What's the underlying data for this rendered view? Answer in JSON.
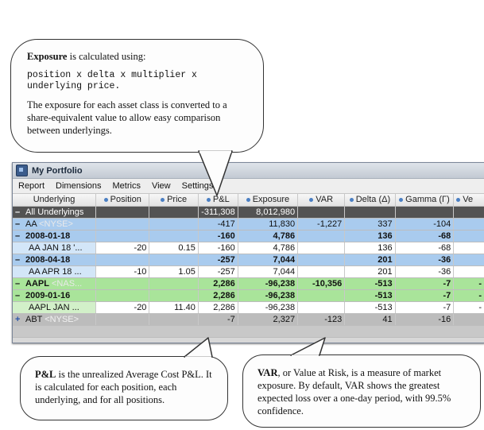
{
  "callouts": {
    "exposure": {
      "term": "Exposure",
      "rest": " is calculated using:",
      "formula": "position x delta x multiplier x\nunderlying price.",
      "note": "The exposure for each asset class is converted to a share-equivalent value to allow easy comparison between underlyings."
    },
    "pnl": {
      "term": "P&L",
      "rest": " is the unrealized Average Cost P&L. It is calculated for each position, each underlying, and for all positions."
    },
    "var": {
      "term": "VAR",
      "rest": ", or Value at Risk, is a measure of market exposure. By default, VAR shows the greatest expected loss over a one-day period, with 99.5% confidence."
    }
  },
  "window": {
    "title": "My Portfolio",
    "menu": [
      "Report",
      "Dimensions",
      "Metrics",
      "View",
      "Settings"
    ]
  },
  "columns": [
    "Underlying",
    "Position",
    "Price",
    "P&L",
    "Exposure",
    "VAR",
    "Delta (Δ)",
    "Gamma (Γ)",
    "Ve"
  ],
  "rows": [
    {
      "toggle": "–",
      "name": "All Underlyings",
      "exch": "",
      "position": "",
      "price": "",
      "pnl": "-311,308",
      "exposure": "8,012,980",
      "var": "",
      "delta": "",
      "gamma": "",
      "vega": ""
    },
    {
      "toggle": "–",
      "name": "AA",
      "exch": " <NYSE>",
      "position": "",
      "price": "",
      "pnl": "-417",
      "exposure": "11,830",
      "var": "-1,227",
      "delta": "337",
      "gamma": "-104",
      "vega": ""
    },
    {
      "toggle": "–",
      "name": "2008-01-18",
      "exch": "",
      "position": "",
      "price": "",
      "pnl": "-160",
      "exposure": "4,786",
      "var": "",
      "delta": "136",
      "gamma": "-68",
      "vega": ""
    },
    {
      "toggle": "",
      "name": "AA JAN 18 '...",
      "exch": "",
      "position": "-20",
      "price": "0.15",
      "pnl": "-160",
      "exposure": "4,786",
      "var": "",
      "delta": "136",
      "gamma": "-68",
      "vega": ""
    },
    {
      "toggle": "–",
      "name": "2008-04-18",
      "exch": "",
      "position": "",
      "price": "",
      "pnl": "-257",
      "exposure": "7,044",
      "var": "",
      "delta": "201",
      "gamma": "-36",
      "vega": ""
    },
    {
      "toggle": "",
      "name": "AA APR 18 ...",
      "exch": "",
      "position": "-10",
      "price": "1.05",
      "pnl": "-257",
      "exposure": "7,044",
      "var": "",
      "delta": "201",
      "gamma": "-36",
      "vega": ""
    },
    {
      "toggle": "–",
      "name": "AAPL",
      "exch": " <NAS...",
      "position": "",
      "price": "",
      "pnl": "2,286",
      "exposure": "-96,238",
      "var": "-10,356",
      "delta": "-513",
      "gamma": "-7",
      "vega": "-"
    },
    {
      "toggle": "–",
      "name": "2009-01-16",
      "exch": "",
      "position": "",
      "price": "",
      "pnl": "2,286",
      "exposure": "-96,238",
      "var": "",
      "delta": "-513",
      "gamma": "-7",
      "vega": "-"
    },
    {
      "toggle": "",
      "name": "AAPL JAN ...",
      "exch": "",
      "position": "-20",
      "price": "11.40",
      "pnl": "2,286",
      "exposure": "-96,238",
      "var": "",
      "delta": "-513",
      "gamma": "-7",
      "vega": "-"
    },
    {
      "toggle": "+",
      "name": "ABT",
      "exch": " <NYSE>",
      "position": "",
      "price": "",
      "pnl": "-7",
      "exposure": "2,327",
      "var": "-123",
      "delta": "41",
      "gamma": "-16",
      "vega": ""
    },
    {
      "toggle": "",
      "name": "",
      "exch": "",
      "position": "",
      "price": "",
      "pnl": "",
      "exposure": "",
      "var": "",
      "delta": "",
      "gamma": "",
      "vega": ""
    }
  ]
}
